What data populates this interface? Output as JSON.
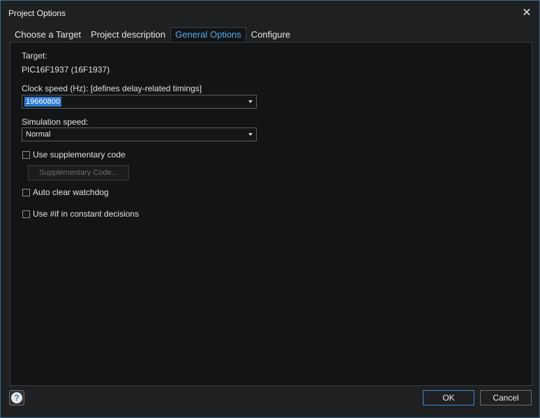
{
  "window": {
    "title": "Project Options",
    "close_glyph": "✕"
  },
  "tabs": [
    {
      "label": "Choose a Target",
      "active": false
    },
    {
      "label": "Project description",
      "active": false
    },
    {
      "label": "General Options",
      "active": true
    },
    {
      "label": "Configure",
      "active": false
    }
  ],
  "general": {
    "target_label": "Target:",
    "target_value": "PIC16F1937 (16F1937)",
    "clock_label": "Clock speed (Hz): [defines delay-related timings]",
    "clock_value": "19660800",
    "sim_label": "Simulation speed:",
    "sim_value": "Normal",
    "use_supp_code_label": "Use supplementary code",
    "use_supp_code_checked": false,
    "supp_code_button": "Supplementary Code...",
    "auto_clear_label": "Auto clear watchdog",
    "auto_clear_checked": false,
    "use_if_label": "Use #if in constant decisions",
    "use_if_checked": false
  },
  "footer": {
    "help_icon": "help-icon",
    "help_glyph": "?",
    "ok_label": "OK",
    "cancel_label": "Cancel"
  },
  "colors": {
    "accent": "#5aa9ea",
    "selection": "#2f7bd0",
    "window_bg": "#1f2022",
    "panel_bg": "#131416"
  }
}
